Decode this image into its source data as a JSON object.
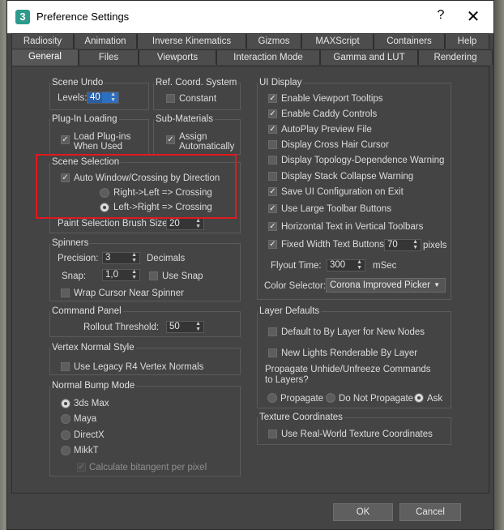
{
  "window": {
    "title": "Preference Settings",
    "help": "?",
    "close": "✕",
    "app_icon": "3"
  },
  "tabs_row1": [
    "Radiosity",
    "Animation",
    "Inverse Kinematics",
    "Gizmos",
    "MAXScript",
    "Containers",
    "Help"
  ],
  "tabs_row2": [
    "General",
    "Files",
    "Viewports",
    "Interaction Mode",
    "Gamma and LUT",
    "Rendering"
  ],
  "active_tab": "General",
  "scene_undo": {
    "title": "Scene Undo",
    "levels_label": "Levels:",
    "levels_value": "40"
  },
  "ref_coord": {
    "title": "Ref. Coord. System",
    "constant_label": "Constant",
    "constant_checked": false
  },
  "plugin_loading": {
    "title": "Plug-In Loading",
    "label_line1": "Load Plug-ins",
    "label_line2": "When Used",
    "checked": true
  },
  "sub_materials": {
    "title": "Sub-Materials",
    "label_line1": "Assign",
    "label_line2": "Automatically",
    "checked": true
  },
  "scene_selection": {
    "title": "Scene Selection",
    "auto_window": "Auto Window/Crossing by Direction",
    "auto_window_checked": true,
    "right_left": "Right->Left => Crossing",
    "right_left_selected": false,
    "left_right": "Left->Right => Crossing",
    "left_right_selected": true,
    "brush_label": "Paint Selection Brush Size",
    "brush_value": "20"
  },
  "spinners": {
    "title": "Spinners",
    "precision_label": "Precision:",
    "precision_value": "3",
    "decimals_label": "Decimals",
    "snap_label": "Snap:",
    "snap_value": "1,0",
    "use_snap": "Use Snap",
    "use_snap_checked": false,
    "wrap_cursor": "Wrap Cursor Near Spinner",
    "wrap_cursor_checked": false
  },
  "command_panel": {
    "title": "Command Panel",
    "rollout_label": "Rollout Threshold:",
    "rollout_value": "50"
  },
  "vertex_normal": {
    "title": "Vertex Normal Style",
    "legacy_label": "Use Legacy R4 Vertex Normals",
    "legacy_checked": false
  },
  "normal_bump": {
    "title": "Normal Bump Mode",
    "options": [
      "3ds Max",
      "Maya",
      "DirectX",
      "MikkT"
    ],
    "selected": "3ds Max",
    "bitangent": "Calculate bitangent per pixel",
    "bitangent_checked": true
  },
  "ui_display": {
    "title": "UI Display",
    "items": [
      {
        "label": "Enable Viewport Tooltips",
        "checked": true
      },
      {
        "label": "Enable Caddy Controls",
        "checked": true
      },
      {
        "label": "AutoPlay Preview File",
        "checked": true
      },
      {
        "label": "Display Cross Hair Cursor",
        "checked": false
      },
      {
        "label": "Display Topology-Dependence Warning",
        "checked": false
      },
      {
        "label": "Display Stack Collapse Warning",
        "checked": false
      },
      {
        "label": "Save UI Configuration on Exit",
        "checked": true
      },
      {
        "label": "Use Large Toolbar Buttons",
        "checked": true
      },
      {
        "label": "Horizontal Text in Vertical Toolbars",
        "checked": true
      },
      {
        "label": "Fixed Width Text Buttons:",
        "checked": true
      }
    ],
    "fixed_width_value": "70",
    "pixels_label": "pixels",
    "flyout_label": "Flyout Time:",
    "flyout_value": "300",
    "msec_label": "mSec",
    "color_selector_label": "Color Selector:",
    "color_selector_value": "Corona Improved Picker"
  },
  "layer_defaults": {
    "title": "Layer Defaults",
    "default_by_layer": "Default to By Layer for New Nodes",
    "default_by_layer_checked": false,
    "new_lights": "New Lights Renderable By Layer",
    "new_lights_checked": false,
    "propagate_line1": "Propagate Unhide/Unfreeze Commands",
    "propagate_line2": "to Layers?",
    "options": [
      "Propagate",
      "Do Not Propagate",
      "Ask"
    ],
    "selected": "Ask"
  },
  "texture_coords": {
    "title": "Texture Coordinates",
    "real_world": "Use Real-World Texture Coordinates",
    "real_world_checked": false
  },
  "buttons": {
    "ok": "OK",
    "cancel": "Cancel"
  },
  "colors": {
    "panel": "#444444",
    "highlight": "#e0191e",
    "accent": "#2d6fbf"
  }
}
